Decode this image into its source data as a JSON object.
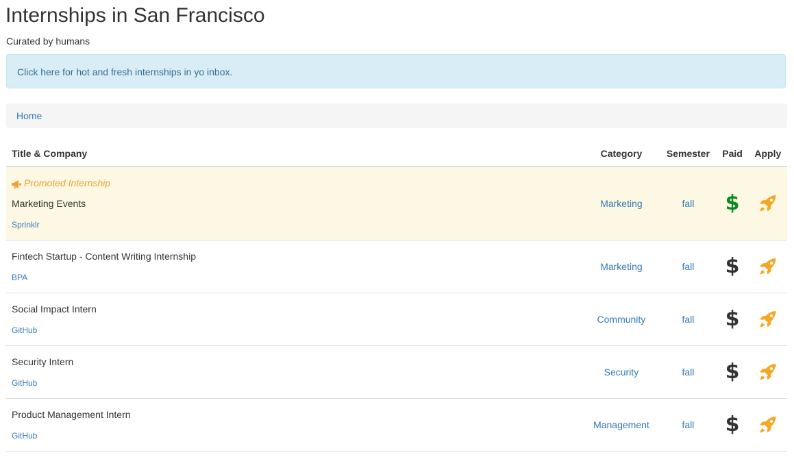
{
  "page": {
    "title": "Internships in San Francisco",
    "subtitle": "Curated by humans"
  },
  "alert": {
    "link_text": "Click here for hot and fresh internships in yo inbox."
  },
  "breadcrumb": {
    "items": [
      "Home"
    ]
  },
  "table": {
    "headers": {
      "title_company": "Title & Company",
      "category": "Category",
      "semester": "Semester",
      "paid": "Paid",
      "apply": "Apply"
    },
    "promoted_label": "Promoted Internship",
    "rows": [
      {
        "promoted": true,
        "title": "Marketing Events",
        "company": "Sprinklr",
        "category": "Marketing",
        "semester": "fall",
        "paid": "$",
        "paid_color": "#0a8a1f",
        "apply_icon": "rocket-icon"
      },
      {
        "promoted": false,
        "title": "Fintech Startup - Content Writing Internship",
        "company": "BPA",
        "category": "Marketing",
        "semester": "fall",
        "paid": "$",
        "paid_color": "#333333",
        "apply_icon": "rocket-icon"
      },
      {
        "promoted": false,
        "title": "Social Impact Intern",
        "company": "GitHub",
        "category": "Community",
        "semester": "fall",
        "paid": "$",
        "paid_color": "#333333",
        "apply_icon": "rocket-icon"
      },
      {
        "promoted": false,
        "title": "Security Intern",
        "company": "GitHub",
        "category": "Security",
        "semester": "fall",
        "paid": "$",
        "paid_color": "#333333",
        "apply_icon": "rocket-icon"
      },
      {
        "promoted": false,
        "title": "Product Management Intern",
        "company": "GitHub",
        "category": "Management",
        "semester": "fall",
        "paid": "$",
        "paid_color": "#333333",
        "apply_icon": "rocket-icon"
      }
    ]
  },
  "colors": {
    "link": "#337ab7",
    "alert_bg": "#d9edf7",
    "alert_text": "#31708f",
    "promoted_bg": "#fcf8e3",
    "promoted_text": "#f0a030",
    "rocket": "#f5a623",
    "paid_green": "#0a8a1f"
  }
}
